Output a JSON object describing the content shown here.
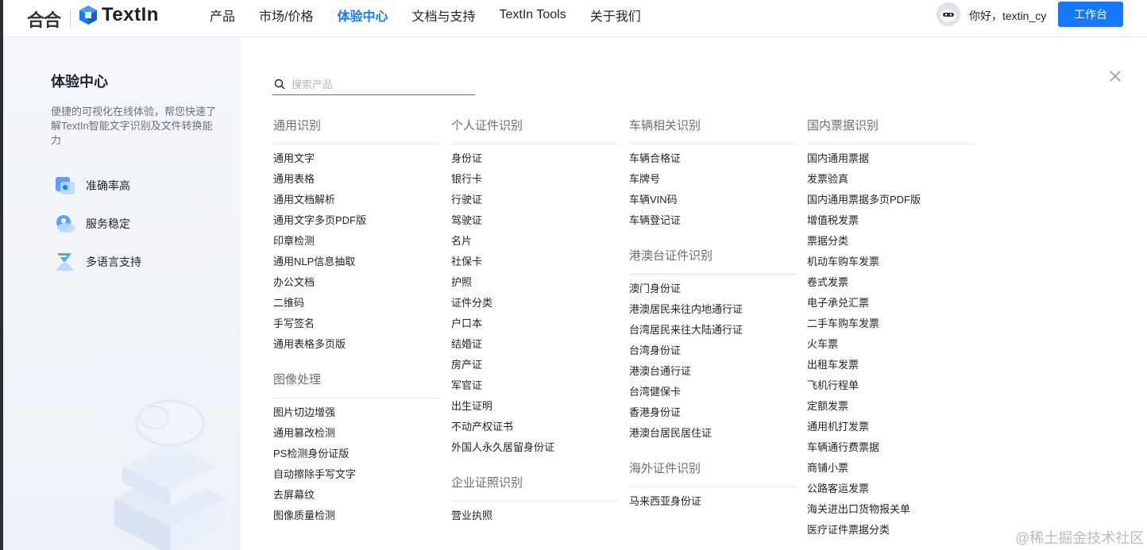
{
  "header": {
    "logo_hehe": "合合",
    "logo_text": "TextIn",
    "nav": [
      {
        "label": "产品",
        "active": false
      },
      {
        "label": "市场/价格",
        "active": false
      },
      {
        "label": "体验中心",
        "active": true
      },
      {
        "label": "文档与支持",
        "active": false
      },
      {
        "label": "TextIn Tools",
        "active": false
      },
      {
        "label": "关于我们",
        "active": false
      }
    ],
    "greeting": "你好，textin_cy",
    "workbench_button": "工作台"
  },
  "side": {
    "title": "体验中心",
    "description": "便捷的可视化在线体验，帮您快速了解TextIn智能文字识别及文件转换能力",
    "features": [
      {
        "label": "准确率高",
        "icon": "accuracy-icon"
      },
      {
        "label": "服务稳定",
        "icon": "stable-service-icon"
      },
      {
        "label": "多语言支持",
        "icon": "multi-language-icon"
      }
    ]
  },
  "search": {
    "placeholder": "搜索产品"
  },
  "columns": [
    [
      {
        "title": "通用识别",
        "items": [
          "通用文字",
          "通用表格",
          "通用文档解析",
          "通用文字多页PDF版",
          "印章检测",
          "通用NLP信息抽取",
          "办公文档",
          "二维码",
          "手写签名",
          "通用表格多页版"
        ]
      },
      {
        "title": "图像处理",
        "items": [
          "图片切边增强",
          "通用篡改检测",
          "PS检测身份证版",
          "自动擦除手写文字",
          "去屏幕纹",
          "图像质量检测"
        ]
      }
    ],
    [
      {
        "title": "个人证件识别",
        "items": [
          "身份证",
          "银行卡",
          "行驶证",
          "驾驶证",
          "名片",
          "社保卡",
          "护照",
          "证件分类",
          "户口本",
          "结婚证",
          "房产证",
          "军官证",
          "出生证明",
          "不动产权证书",
          "外国人永久居留身份证"
        ]
      },
      {
        "title": "企业证照识别",
        "items": [
          "营业执照"
        ]
      }
    ],
    [
      {
        "title": "车辆相关识别",
        "items": [
          "车辆合格证",
          "车牌号",
          "车辆VIN码",
          "车辆登记证"
        ]
      },
      {
        "title": "港澳台证件识别",
        "items": [
          "澳门身份证",
          "港澳居民来往内地通行证",
          "台湾居民来往大陆通行证",
          "台湾身份证",
          "港澳台通行证",
          "台湾健保卡",
          "香港身份证",
          "港澳台居民居住证"
        ]
      },
      {
        "title": "海外证件识别",
        "items": [
          "马来西亚身份证"
        ]
      }
    ],
    [
      {
        "title": "国内票据识别",
        "items": [
          "国内通用票据",
          "发票验真",
          "国内通用票据多页PDF版",
          "增值税发票",
          "票据分类",
          "机动车购车发票",
          "卷式发票",
          "电子承兑汇票",
          "二手车购车发票",
          "火车票",
          "出租车发票",
          "飞机行程单",
          "定额发票",
          "通用机打发票",
          "车辆通行费票据",
          "商铺小票",
          "公路客运发票",
          "海关进出口货物报关单",
          "医疗证件票据分类"
        ]
      }
    ]
  ],
  "watermark": "@稀土掘金技术社区",
  "colors": {
    "accent": "#1677ff",
    "side_bg": "#f1f4f9"
  }
}
